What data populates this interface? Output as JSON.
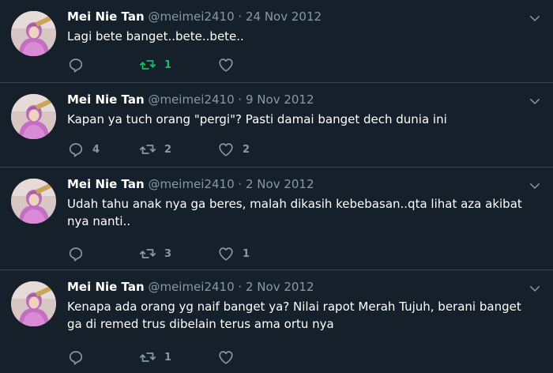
{
  "colors": {
    "background": "#15202b",
    "divider": "#38444d",
    "muted": "#8899a6",
    "retweet_active": "#17bf63"
  },
  "tweets": [
    {
      "name": "Mei Nie Tan",
      "handle": "@meimei2410",
      "sep": "·",
      "date": "24 Nov 2012",
      "text": "Lagi bete banget..bete..bete..",
      "replies": "",
      "retweets": "1",
      "likes": "",
      "retweeted": true
    },
    {
      "name": "Mei Nie Tan",
      "handle": "@meimei2410",
      "sep": "·",
      "date": "9 Nov 2012",
      "text": "Kapan ya tuch orang \"pergi\"? Pasti damai banget dech dunia ini",
      "replies": "4",
      "retweets": "2",
      "likes": "2",
      "retweeted": false
    },
    {
      "name": "Mei Nie Tan",
      "handle": "@meimei2410",
      "sep": "·",
      "date": "2 Nov 2012",
      "text": "Udah tahu anak nya ga beres, malah dikasih kebebasan..qta lihat aza akibat nya nanti..",
      "replies": "",
      "retweets": "3",
      "likes": "1",
      "retweeted": false
    },
    {
      "name": "Mei Nie Tan",
      "handle": "@meimei2410",
      "sep": "·",
      "date": "2 Nov 2012",
      "text": "Kenapa ada orang yg naif banget ya? Nilai rapot Merah Tujuh, berani banget ga di remed trus dibelain terus ama ortu nya",
      "replies": "",
      "retweets": "1",
      "likes": "",
      "retweeted": false
    }
  ]
}
